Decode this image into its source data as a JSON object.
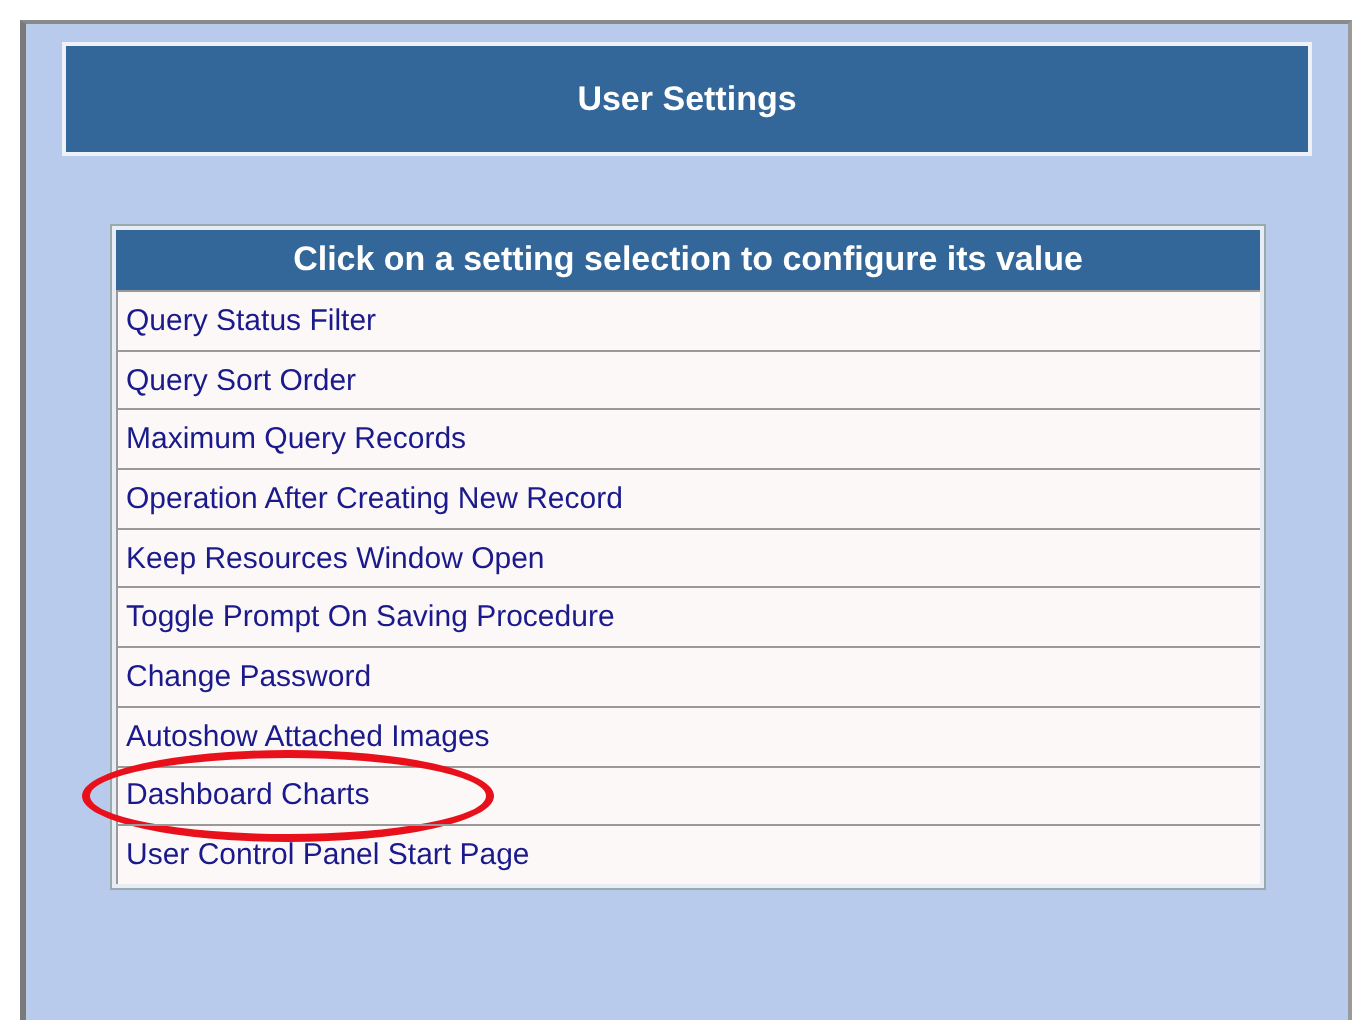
{
  "title": "User Settings",
  "table": {
    "header": "Click on a setting selection to configure its value",
    "rows": [
      {
        "label": "Query Status Filter",
        "circled": false
      },
      {
        "label": "Query Sort Order",
        "circled": false
      },
      {
        "label": "Maximum Query Records",
        "circled": false
      },
      {
        "label": "Operation After Creating New Record",
        "circled": false
      },
      {
        "label": "Keep Resources Window Open",
        "circled": false
      },
      {
        "label": "Toggle Prompt On Saving Procedure",
        "circled": false
      },
      {
        "label": "Change Password",
        "circled": false
      },
      {
        "label": "Autoshow Attached Images",
        "circled": false
      },
      {
        "label": "Dashboard Charts",
        "circled": true
      },
      {
        "label": "User Control Panel Start Page",
        "circled": false
      }
    ]
  }
}
